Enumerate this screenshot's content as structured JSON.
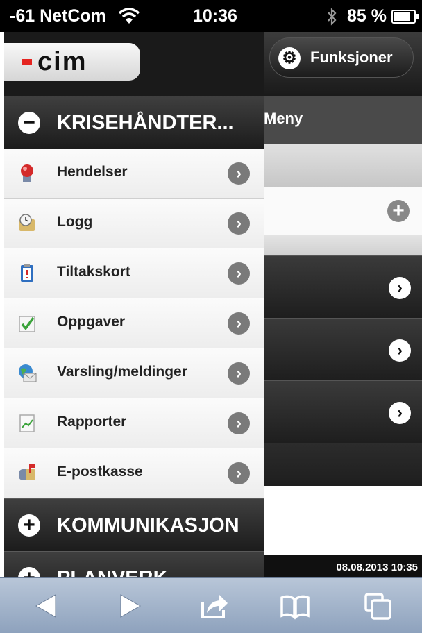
{
  "status_bar": {
    "carrier": "-61 NetCom",
    "time": "10:36",
    "battery": "85 %",
    "icons": [
      "wifi-icon",
      "bluetooth-icon",
      "battery-icon"
    ]
  },
  "logo": {
    "text": "cim"
  },
  "header": {
    "funksjoner_label": "Funksjoner"
  },
  "background": {
    "meny_label": "Meny",
    "date": "08.08.2013 10:35"
  },
  "menu": {
    "section_open": "KRISEHÅNDTER...",
    "items": [
      {
        "label": "Hendelser",
        "icon": "alarm-icon"
      },
      {
        "label": "Logg",
        "icon": "log-icon"
      },
      {
        "label": "Tiltakskort",
        "icon": "clipboard-icon"
      },
      {
        "label": "Oppgaver",
        "icon": "checkmark-icon"
      },
      {
        "label": "Varsling/meldinger",
        "icon": "globe-mail-icon"
      },
      {
        "label": "Rapporter",
        "icon": "report-icon"
      },
      {
        "label": "E-postkasse",
        "icon": "mailbox-icon"
      }
    ],
    "section_2": "KOMMUNIKASJON",
    "section_3": "PLANVERK"
  },
  "colors": {
    "panel_dark": "#1c1c1c",
    "toolbar_blue": "#8ea2bd",
    "logo_red": "#e52420"
  }
}
